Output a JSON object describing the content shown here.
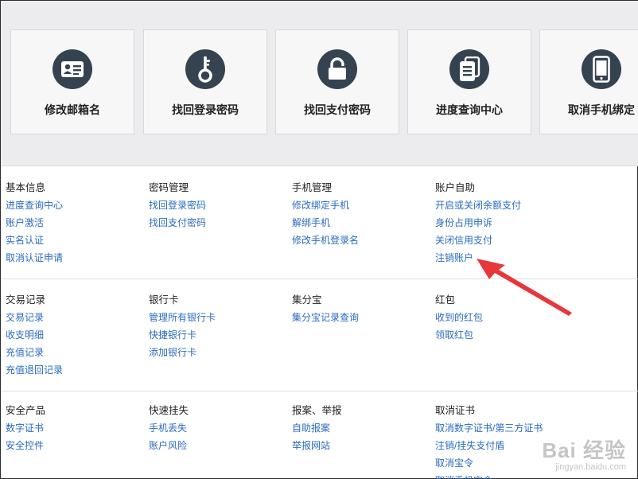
{
  "cards": [
    {
      "label": "修改邮箱名",
      "icon": "id-card-icon"
    },
    {
      "label": "找回登录密码",
      "icon": "key-icon"
    },
    {
      "label": "找回支付密码",
      "icon": "padlock-icon"
    },
    {
      "label": "进度查询中心",
      "icon": "documents-icon"
    },
    {
      "label": "取消手机绑定",
      "icon": "mobile-phone-icon"
    }
  ],
  "sections": [
    {
      "columns": [
        {
          "title": "基本信息",
          "links": [
            "进度查询中心",
            "账户激活",
            "实名认证",
            "取消认证申请"
          ]
        },
        {
          "title": "密码管理",
          "links": [
            "找回登录密码",
            "找回支付密码"
          ]
        },
        {
          "title": "手机管理",
          "links": [
            "修改绑定手机",
            "解绑手机",
            "修改手机登录名"
          ]
        },
        {
          "title": "账户自助",
          "links": [
            "开启或关闭余额支付",
            "身份占用申诉",
            "关闭信用支付",
            "注销账户"
          ]
        }
      ]
    },
    {
      "columns": [
        {
          "title": "交易记录",
          "links": [
            "交易记录",
            "收支明细",
            "充值记录",
            "充值退回记录"
          ]
        },
        {
          "title": "银行卡",
          "links": [
            "管理所有银行卡",
            "快捷银行卡",
            "添加银行卡"
          ]
        },
        {
          "title": "集分宝",
          "links": [
            "集分宝记录查询"
          ]
        },
        {
          "title": "红包",
          "links": [
            "收到的红包",
            "领取红包"
          ]
        }
      ]
    },
    {
      "columns": [
        {
          "title": "安全产品",
          "links": [
            "数字证书",
            "安全控件"
          ]
        },
        {
          "title": "快速挂失",
          "links": [
            "手机丢失",
            "账户风险"
          ]
        },
        {
          "title": "报案、举报",
          "links": [
            "自助报案",
            "举报网站"
          ]
        },
        {
          "title": "取消证书",
          "links": [
            "取消数字证书/第三方证书",
            "注销/挂失支付盾",
            "取消宝令",
            "取消手机宝令"
          ]
        }
      ]
    }
  ],
  "watermark": {
    "brand": "Bai 经验",
    "url": "jingyan.baidu.com"
  },
  "colors": {
    "link": "#2a6bbf",
    "icon_bg": "#35424f",
    "arrow": "#e8363a"
  }
}
